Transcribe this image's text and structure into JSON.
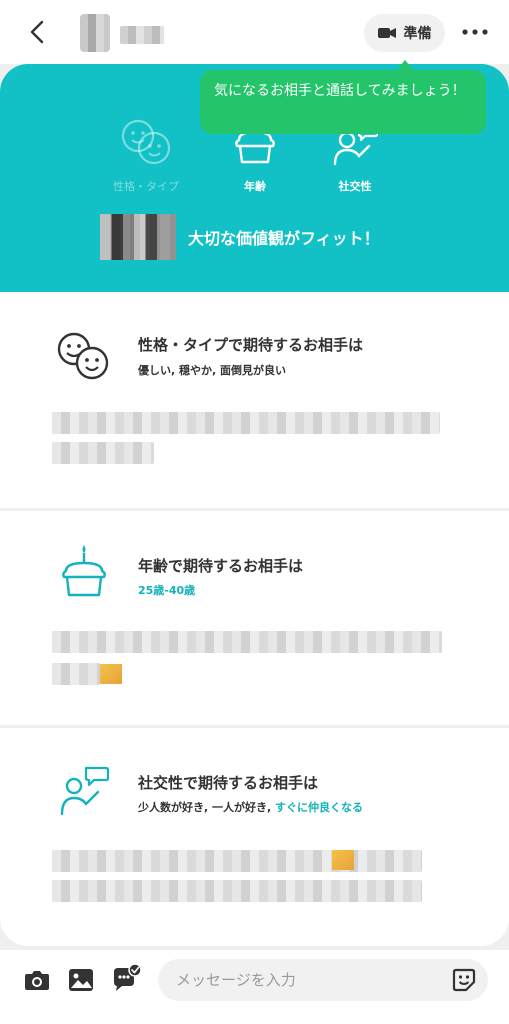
{
  "header": {
    "prep_label": "準備"
  },
  "tooltip": {
    "text": "気になるお相手と通話してみましょう！"
  },
  "hero": {
    "items": [
      {
        "label": "性格・タイプ"
      },
      {
        "label": "年齢"
      },
      {
        "label": "社交性"
      }
    ],
    "headline": "大切な価値観がフィット！"
  },
  "cards": [
    {
      "title": "性格・タイプで期待するお相手は",
      "subtitle": "優しい, 穏やか, 面倒見が良い"
    },
    {
      "title": "年齢で期待するお相手は",
      "subtitle": "25歳-40歳"
    },
    {
      "title": "社交性で期待するお相手は",
      "subtitle_plain": "少人数が好き, 一人が好き, ",
      "subtitle_highlight": "すぐに仲良くなる"
    }
  ],
  "bottom": {
    "input_placeholder": "メッセージを入力"
  },
  "colors": {
    "teal": "#11c1c6",
    "green": "#23c46a",
    "accent_text": "#13b3bb"
  }
}
